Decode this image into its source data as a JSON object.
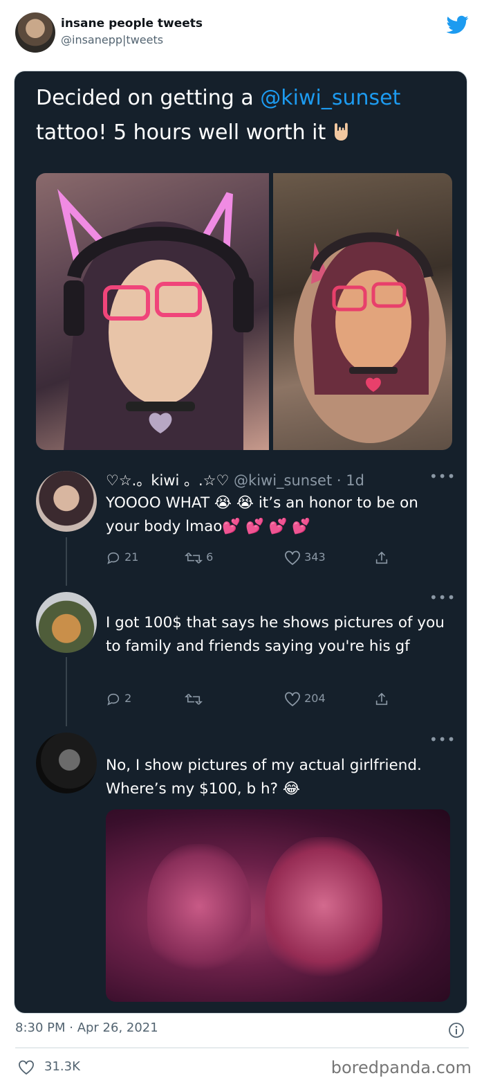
{
  "tweet": {
    "author_name": "insane people tweets",
    "author_handle": "@insanepp|tweets",
    "date": "8:30 PM · Apr 26, 2021",
    "likes": "31.3K",
    "icons": {
      "platform": "twitter-bird-icon",
      "info": "info-icon",
      "like": "heart-icon"
    },
    "brand_color": "#1d9bf0"
  },
  "screenshot": {
    "text_before": "Decided on getting a ",
    "mention": "@kiwi_sunset",
    "text_after": " tattoo! 5 hours well worth it",
    "emoji": "rock-on-hand-icon",
    "replies": [
      {
        "name": "♡☆.。kiwi 。.☆♡",
        "handle": "@kiwi_sunset",
        "time": "· 1d",
        "text": "YOOOO WHAT 😭 😭 it’s an honor to be on your body lmao💕 💕 💕 💕",
        "comments": "21",
        "retweets": "6",
        "likes": "343"
      },
      {
        "text": "I got 100$ that says he shows pictures of you to family and friends saying you're his gf",
        "comments": "2",
        "retweets": "",
        "likes": "204"
      },
      {
        "text": "No, I show pictures of my actual girlfriend. Where’s my $100, b    h? 😂"
      }
    ]
  },
  "watermark": "boredpanda.com"
}
